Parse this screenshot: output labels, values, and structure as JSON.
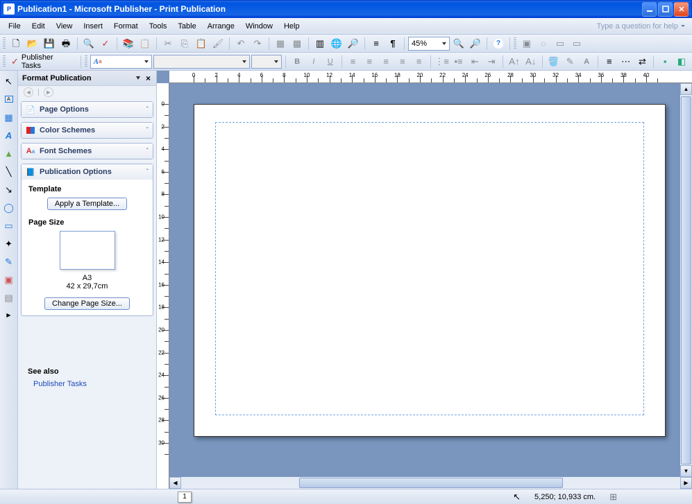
{
  "title": "Publication1 - Microsoft Publisher - Print Publication",
  "menu": [
    "File",
    "Edit",
    "View",
    "Insert",
    "Format",
    "Tools",
    "Table",
    "Arrange",
    "Window",
    "Help"
  ],
  "help_placeholder": "Type a question for help",
  "zoom": "45%",
  "publisher_tasks_label": "Publisher Tasks",
  "styles_placeholder": "",
  "font_placeholder": "",
  "size_placeholder": "",
  "taskpane": {
    "title": "Format Publication",
    "sections": {
      "page_options": "Page Options",
      "color_schemes": "Color Schemes",
      "font_schemes": "Font Schemes",
      "publication_options": "Publication Options"
    },
    "template_label": "Template",
    "apply_template_btn": "Apply a Template...",
    "page_size_label": "Page Size",
    "page_size_name": "A3",
    "page_size_dims": "42 x 29,7cm",
    "change_size_btn": "Change Page Size...",
    "see_also": "See also",
    "see_also_link": "Publisher Tasks"
  },
  "status": {
    "page_num": "1",
    "coords": "5,250; 10,933 cm."
  },
  "ruler_h": [
    0,
    2,
    4,
    6,
    8,
    10,
    12,
    14,
    16,
    18,
    20,
    22,
    24,
    26,
    28,
    30,
    32,
    34,
    36,
    38,
    40
  ],
  "ruler_v": [
    0,
    2,
    4,
    6,
    8,
    10,
    12,
    14,
    16,
    18,
    20,
    22,
    24,
    26,
    28,
    30
  ]
}
